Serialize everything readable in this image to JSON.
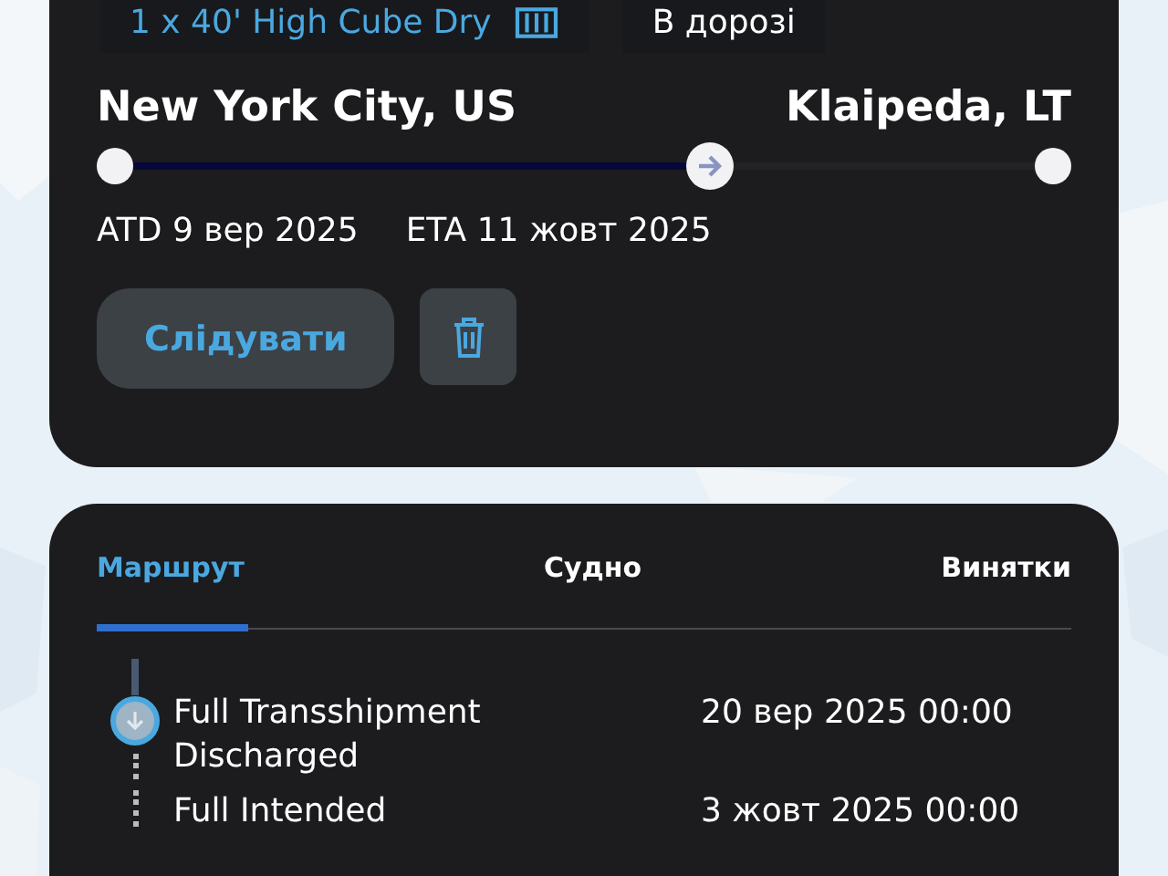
{
  "shipment": {
    "container": "1 x 40' High Cube Dry",
    "status": "В дорозі",
    "origin": "New York City, US",
    "destination": "Klaipeda, LT",
    "progress": {
      "level": 0.64
    },
    "atd": "ATD 9 вер 2025",
    "eta": "ETA 11 жовт 2025",
    "follow_button": "Слідувати"
  },
  "tabs": [
    {
      "label": "Маршрут",
      "selected": true
    },
    {
      "label": "Судно",
      "selected": false
    },
    {
      "label": "Винятки",
      "selected": false
    }
  ],
  "events": [
    {
      "title": "Full Transshipment Discharged",
      "date": "20 вер 2025 00:00",
      "kind": "current"
    },
    {
      "title": "Full Intended",
      "date": "3 жовт 2025 00:00",
      "kind": "upcoming"
    }
  ]
}
